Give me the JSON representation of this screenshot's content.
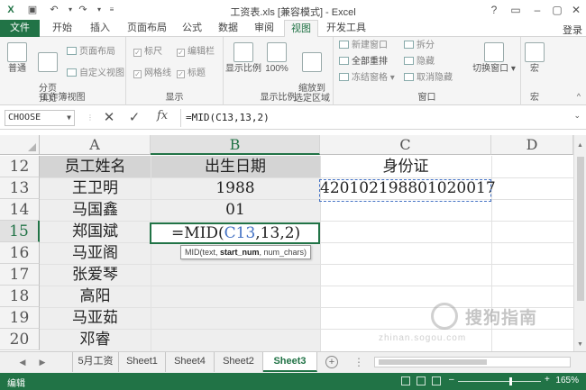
{
  "window": {
    "title": "工资表.xls  [兼容模式] - Excel",
    "controls": [
      "?",
      "▭",
      "–",
      "▢",
      "✕"
    ]
  },
  "quick_access": {
    "icons": [
      "excel-logo-icon",
      "save-icon",
      "undo-icon",
      "redo-icon",
      "customize-icon"
    ]
  },
  "tabs": [
    {
      "label": "文件"
    },
    {
      "label": "开始"
    },
    {
      "label": "插入"
    },
    {
      "label": "页面布局"
    },
    {
      "label": "公式"
    },
    {
      "label": "数据"
    },
    {
      "label": "审阅"
    },
    {
      "label": "视图"
    },
    {
      "label": "开发工具"
    }
  ],
  "active_tab": "视图",
  "signin": "登录",
  "ribbon": {
    "groups": {
      "workbook_views": {
        "label": "工作簿视图",
        "normal": "普通",
        "page_break": "分页\n预览",
        "page_layout": "页面布局",
        "custom_views": "自定义视图"
      },
      "show": {
        "label": "显示",
        "ruler": "标尺",
        "gridlines": "网格线",
        "formula_bar": "编辑栏",
        "headings": "标题"
      },
      "zoom": {
        "label": "显示比例",
        "zoom": "显示比例",
        "hundred": "100%",
        "zoom_selection": "缩放到\n选定区域"
      },
      "window": {
        "label": "窗口",
        "new_window": "新建窗口",
        "arrange_all": "全部重排",
        "freeze_panes": "冻结窗格",
        "split": "拆分",
        "hide": "隐藏",
        "unhide": "取消隐藏",
        "switch_windows": "切换窗口"
      },
      "macros": {
        "label": "宏",
        "macro": "宏"
      }
    }
  },
  "formula_bar": {
    "name_box": "CHOOSE",
    "cancel": "✕",
    "enter": "✓",
    "fx": "fx",
    "formula": "=MID(C13,13,2)"
  },
  "grid": {
    "columns": [
      "A",
      "B",
      "C",
      "D"
    ],
    "rows": [
      "12",
      "13",
      "14",
      "15",
      "16",
      "17",
      "18",
      "19",
      "20"
    ],
    "cells": {
      "A12": "员工姓名",
      "B12": "出生日期",
      "C12": "身份证",
      "A13": "王卫明",
      "B13": "1988",
      "C13": "420102198801020017",
      "A14": "马国鑫",
      "B14": "01",
      "A15": "郑国斌",
      "A16": "马亚阁",
      "A17": "张爱琴",
      "A18": "高阳",
      "A19": "马亚茹",
      "A20": "邓睿"
    },
    "editing": {
      "cell": "B15",
      "prefix": "=MID(",
      "ref": "C13",
      "suffix": ",13,2)"
    },
    "tooltip": {
      "fn": "MID(text, ",
      "bold": "start_num",
      "rest": ", num_chars)"
    }
  },
  "sheets": [
    "5月工资",
    "Sheet1",
    "Sheet4",
    "Sheet2",
    "Sheet3"
  ],
  "active_sheet": "Sheet3",
  "status": {
    "mode": "编辑",
    "zoom": "165%"
  },
  "watermark": {
    "text": "搜狗指南",
    "url": "zhinan.sogou.com"
  },
  "colors": {
    "excel_green": "#217346",
    "ref_blue": "#4472c4"
  }
}
